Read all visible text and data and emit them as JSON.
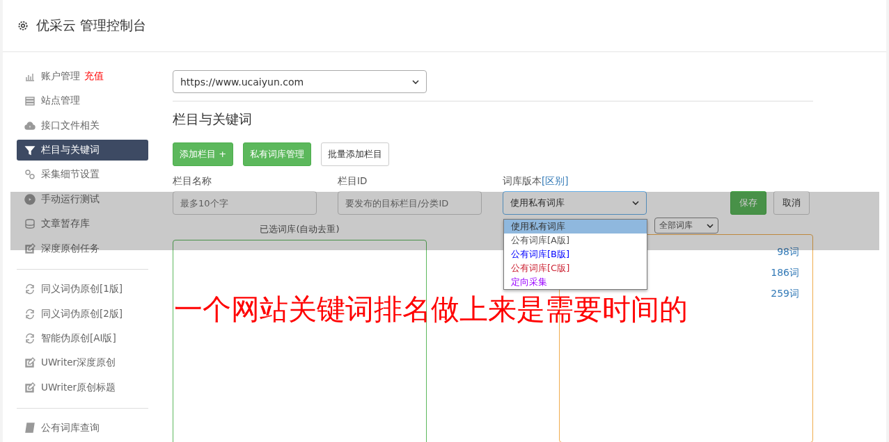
{
  "header": {
    "title": "优采云 管理控制台"
  },
  "sidebar": {
    "groups": [
      [
        {
          "label": "账户管理",
          "badge": "充值",
          "selected": false
        },
        {
          "label": "站点管理",
          "selected": false
        },
        {
          "label": "接口文件相关",
          "selected": false
        },
        {
          "label": "栏目与关键词",
          "selected": true
        },
        {
          "label": "采集细节设置",
          "selected": false
        },
        {
          "label": "手动运行测试",
          "selected": false
        },
        {
          "label": "文章暂存库",
          "selected": false
        },
        {
          "label": "深度原创任务",
          "selected": false
        }
      ],
      [
        {
          "label": "同义词伪原创[1版]",
          "selected": false
        },
        {
          "label": "同义词伪原创[2版]",
          "selected": false
        },
        {
          "label": "智能伪原创[AI版]",
          "selected": false
        },
        {
          "label": "UWriter深度原创",
          "selected": false
        },
        {
          "label": "UWriter原创标题",
          "selected": false
        }
      ],
      [
        {
          "label": "公有词库查询",
          "selected": false
        }
      ]
    ]
  },
  "site_select": {
    "value": "https://www.ucaiyun.com"
  },
  "section_title": "栏目与关键词",
  "buttons": [
    {
      "label": "添加栏目 +",
      "kind": "primary"
    },
    {
      "label": "私有词库管理",
      "kind": "primary"
    },
    {
      "label": "批量添加栏目",
      "kind": "default"
    }
  ],
  "form": {
    "name_label": "栏目名称",
    "name_placeholder": "最多10个字",
    "id_label": "栏目ID",
    "id_placeholder": "要发布的目标栏目/分类ID",
    "version_label": "词库版本",
    "version_link": "[区别]",
    "version_value": "使用私有词库",
    "save": "保存",
    "cancel": "取消"
  },
  "version_options": [
    {
      "label": "使用私有词库",
      "selected": true,
      "color": "#333333"
    },
    {
      "label": "公有词库[A版]",
      "selected": false,
      "color": "#555555"
    },
    {
      "label": "公有词库[B版]",
      "selected": false,
      "color": "#0000ff"
    },
    {
      "label": "公有词库[C版]",
      "selected": false,
      "color": "#cc2233"
    },
    {
      "label": "定向采集",
      "selected": false,
      "color": "#9900ff"
    }
  ],
  "selected_panel": {
    "title": "已选词库(自动去重)"
  },
  "library_panel": {
    "filter_value": "全部词库",
    "rows": [
      {
        "count": "98词"
      },
      {
        "count": "186词"
      },
      {
        "count": "259词"
      }
    ]
  },
  "caption": "一个网站关键词排名做上来是需要时间的"
}
